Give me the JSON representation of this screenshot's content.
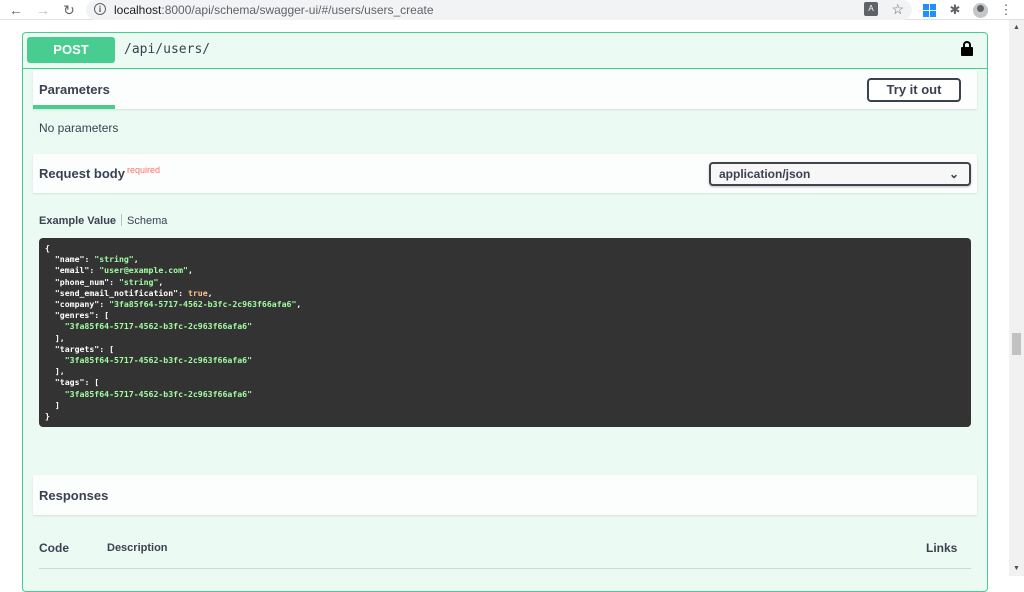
{
  "browser": {
    "url_host": "localhost",
    "url_path": ":8000/api/schema/swagger-ui/#/users/users_create"
  },
  "operation": {
    "method": "POST",
    "path": "/api/users/",
    "colors": {
      "accent": "#49cc90",
      "text": "#3b4151"
    }
  },
  "parameters": {
    "tab_label": "Parameters",
    "try_button": "Try it out",
    "empty_text": "No parameters"
  },
  "request_body": {
    "title": "Request body",
    "required_label": "required",
    "content_type": "application/json",
    "example_tab": "Example Value",
    "schema_tab": "Schema",
    "example_lines": [
      [
        {
          "t": "p",
          "v": "{"
        }
      ],
      [
        {
          "t": "p",
          "v": "  "
        },
        {
          "t": "k",
          "v": "\"name\""
        },
        {
          "t": "p",
          "v": ": "
        },
        {
          "t": "s",
          "v": "\"string\""
        },
        {
          "t": "p",
          "v": ","
        }
      ],
      [
        {
          "t": "p",
          "v": "  "
        },
        {
          "t": "k",
          "v": "\"email\""
        },
        {
          "t": "p",
          "v": ": "
        },
        {
          "t": "s",
          "v": "\"user@example.com\""
        },
        {
          "t": "p",
          "v": ","
        }
      ],
      [
        {
          "t": "p",
          "v": "  "
        },
        {
          "t": "k",
          "v": "\"phone_num\""
        },
        {
          "t": "p",
          "v": ": "
        },
        {
          "t": "s",
          "v": "\"string\""
        },
        {
          "t": "p",
          "v": ","
        }
      ],
      [
        {
          "t": "p",
          "v": "  "
        },
        {
          "t": "k",
          "v": "\"send_email_notification\""
        },
        {
          "t": "p",
          "v": ": "
        },
        {
          "t": "b",
          "v": "true"
        },
        {
          "t": "p",
          "v": ","
        }
      ],
      [
        {
          "t": "p",
          "v": "  "
        },
        {
          "t": "k",
          "v": "\"company\""
        },
        {
          "t": "p",
          "v": ": "
        },
        {
          "t": "s",
          "v": "\"3fa85f64-5717-4562-b3fc-2c963f66afa6\""
        },
        {
          "t": "p",
          "v": ","
        }
      ],
      [
        {
          "t": "p",
          "v": "  "
        },
        {
          "t": "k",
          "v": "\"genres\""
        },
        {
          "t": "p",
          "v": ": ["
        }
      ],
      [
        {
          "t": "p",
          "v": "    "
        },
        {
          "t": "s",
          "v": "\"3fa85f64-5717-4562-b3fc-2c963f66afa6\""
        }
      ],
      [
        {
          "t": "p",
          "v": "  ],"
        }
      ],
      [
        {
          "t": "p",
          "v": "  "
        },
        {
          "t": "k",
          "v": "\"targets\""
        },
        {
          "t": "p",
          "v": ": ["
        }
      ],
      [
        {
          "t": "p",
          "v": "    "
        },
        {
          "t": "s",
          "v": "\"3fa85f64-5717-4562-b3fc-2c963f66afa6\""
        }
      ],
      [
        {
          "t": "p",
          "v": "  ],"
        }
      ],
      [
        {
          "t": "p",
          "v": "  "
        },
        {
          "t": "k",
          "v": "\"tags\""
        },
        {
          "t": "p",
          "v": ": ["
        }
      ],
      [
        {
          "t": "p",
          "v": "    "
        },
        {
          "t": "s",
          "v": "\"3fa85f64-5717-4562-b3fc-2c963f66afa6\""
        }
      ],
      [
        {
          "t": "p",
          "v": "  ]"
        }
      ],
      [
        {
          "t": "p",
          "v": "}"
        }
      ]
    ]
  },
  "responses": {
    "title": "Responses",
    "columns": {
      "code": "Code",
      "description": "Description",
      "links": "Links"
    }
  }
}
